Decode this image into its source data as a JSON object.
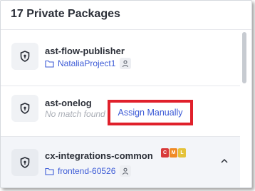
{
  "header": {
    "title": "17 Private Packages"
  },
  "packages": [
    {
      "name": "ast-flow-publisher",
      "repo": "NataliaProject1"
    },
    {
      "name": "ast-onelog",
      "status": "No match found",
      "action": "Assign Manually"
    },
    {
      "name": "cx-integrations-common",
      "repo": "frontend-60526",
      "badges": [
        {
          "letter": "C",
          "color": "#d83a3a"
        },
        {
          "letter": "M",
          "color": "#f08a24"
        },
        {
          "letter": "L",
          "color": "#e4c23a"
        }
      ]
    }
  ],
  "colors": {
    "accent": "#3b5ad6",
    "highlight": "#e0202b"
  },
  "icons": {
    "package": "lock-shield-icon",
    "repo": "folder-icon",
    "owner": "user-icon",
    "expand": "chevron-up-icon"
  }
}
